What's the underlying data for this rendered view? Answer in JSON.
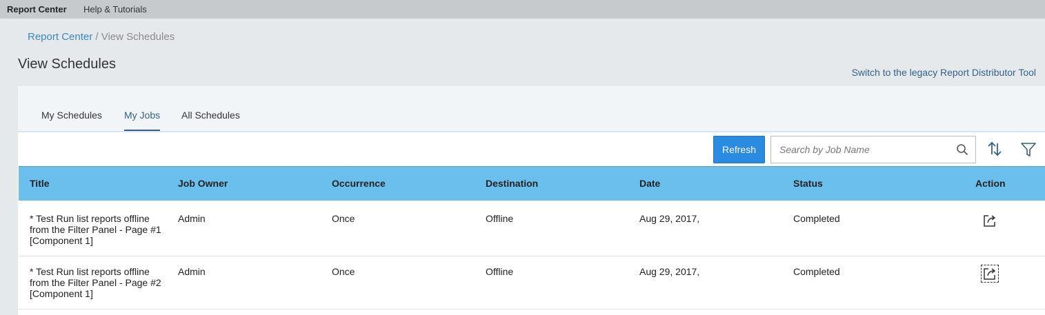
{
  "topbar": {
    "app_title": "Report Center",
    "help": "Help & Tutorials"
  },
  "breadcrumb": {
    "root": "Report Center",
    "separator": " / ",
    "current": "View Schedules"
  },
  "page": {
    "title": "View Schedules",
    "legacy_link": "Switch to the legacy Report Distributor Tool"
  },
  "tabs": [
    {
      "label": "My Schedules",
      "active": false
    },
    {
      "label": "My Jobs",
      "active": true
    },
    {
      "label": "All Schedules",
      "active": false
    }
  ],
  "toolbar": {
    "refresh_label": "Refresh",
    "search_placeholder": "Search by Job Name",
    "search_icon": "search-icon",
    "sort_icon": "sort-icon",
    "filter_icon": "filter-icon"
  },
  "table": {
    "columns": [
      "Title",
      "Job Owner",
      "Occurrence",
      "Destination",
      "Date",
      "Status",
      "Action"
    ],
    "rows": [
      {
        "title": "* Test Run list reports offline from the Filter Panel - Page #1 [Component 1]",
        "owner": "Admin",
        "occurrence": "Once",
        "destination": "Offline",
        "date": "Aug 29, 2017,",
        "status": "Completed",
        "action_icon": "export-icon"
      },
      {
        "title": "* Test Run list reports offline from the Filter Panel - Page #2 [Component 1]",
        "owner": "Admin",
        "occurrence": "Once",
        "destination": "Offline",
        "date": "Aug 29, 2017,",
        "status": "Completed",
        "action_icon": "export-icon"
      }
    ]
  },
  "colors": {
    "accent": "#2a8be0",
    "header_bg": "#6bbfed",
    "link": "#346187"
  }
}
